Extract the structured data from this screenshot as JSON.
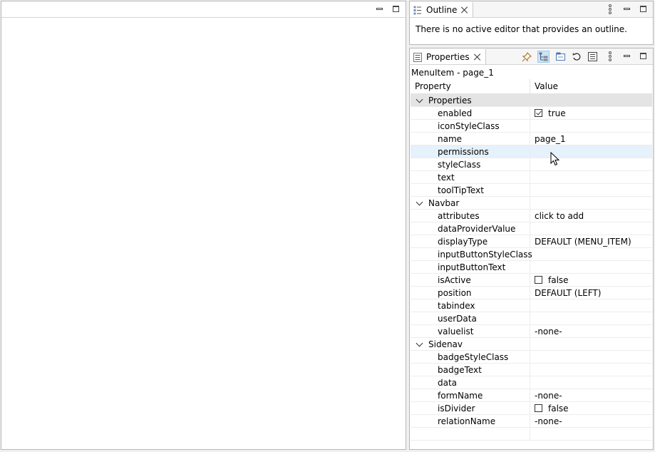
{
  "outline": {
    "tab_label": "Outline",
    "message": "There is no active editor that provides an outline."
  },
  "properties_view": {
    "tab_label": "Properties",
    "breadcrumb": "MenuItem - page_1",
    "columns": {
      "property": "Property",
      "value": "Value"
    },
    "categories": [
      {
        "name": "Properties",
        "rows": [
          {
            "name": "enabled",
            "value": "true",
            "checkbox": "checked"
          },
          {
            "name": "iconStyleClass",
            "value": ""
          },
          {
            "name": "name",
            "value": "page_1"
          },
          {
            "name": "permissions",
            "value": "",
            "highlighted": true
          },
          {
            "name": "styleClass",
            "value": ""
          },
          {
            "name": "text",
            "value": ""
          },
          {
            "name": "toolTipText",
            "value": ""
          }
        ]
      },
      {
        "name": "Navbar",
        "rows": [
          {
            "name": "attributes",
            "value": "click to add"
          },
          {
            "name": "dataProviderValue",
            "value": ""
          },
          {
            "name": "displayType",
            "value": "DEFAULT (MENU_ITEM)"
          },
          {
            "name": "inputButtonStyleClass",
            "value": ""
          },
          {
            "name": "inputButtonText",
            "value": ""
          },
          {
            "name": "isActive",
            "value": "false",
            "checkbox": "unchecked"
          },
          {
            "name": "position",
            "value": "DEFAULT (LEFT)"
          },
          {
            "name": "tabindex",
            "value": ""
          },
          {
            "name": "userData",
            "value": ""
          },
          {
            "name": "valuelist",
            "value": "-none-"
          }
        ]
      },
      {
        "name": "Sidenav",
        "rows": [
          {
            "name": "badgeStyleClass",
            "value": ""
          },
          {
            "name": "badgeText",
            "value": ""
          },
          {
            "name": "data",
            "value": ""
          },
          {
            "name": "formName",
            "value": "-none-"
          },
          {
            "name": "isDivider",
            "value": "false",
            "checkbox": "unchecked"
          },
          {
            "name": "relationName",
            "value": "-none-"
          }
        ]
      }
    ],
    "toolbar_icons": [
      "pin-icon",
      "show-categories-icon",
      "show-advanced-icon",
      "restore-default-icon",
      "properties-sheet-icon",
      "view-menu-icon"
    ]
  },
  "colors": {
    "panel_bg": "#ffffff",
    "workbench_bg": "#f0f0f0",
    "highlight_row": "#e5f1fb",
    "category_bg": "#e4e4e4",
    "active_tool": "#cce4f7"
  }
}
